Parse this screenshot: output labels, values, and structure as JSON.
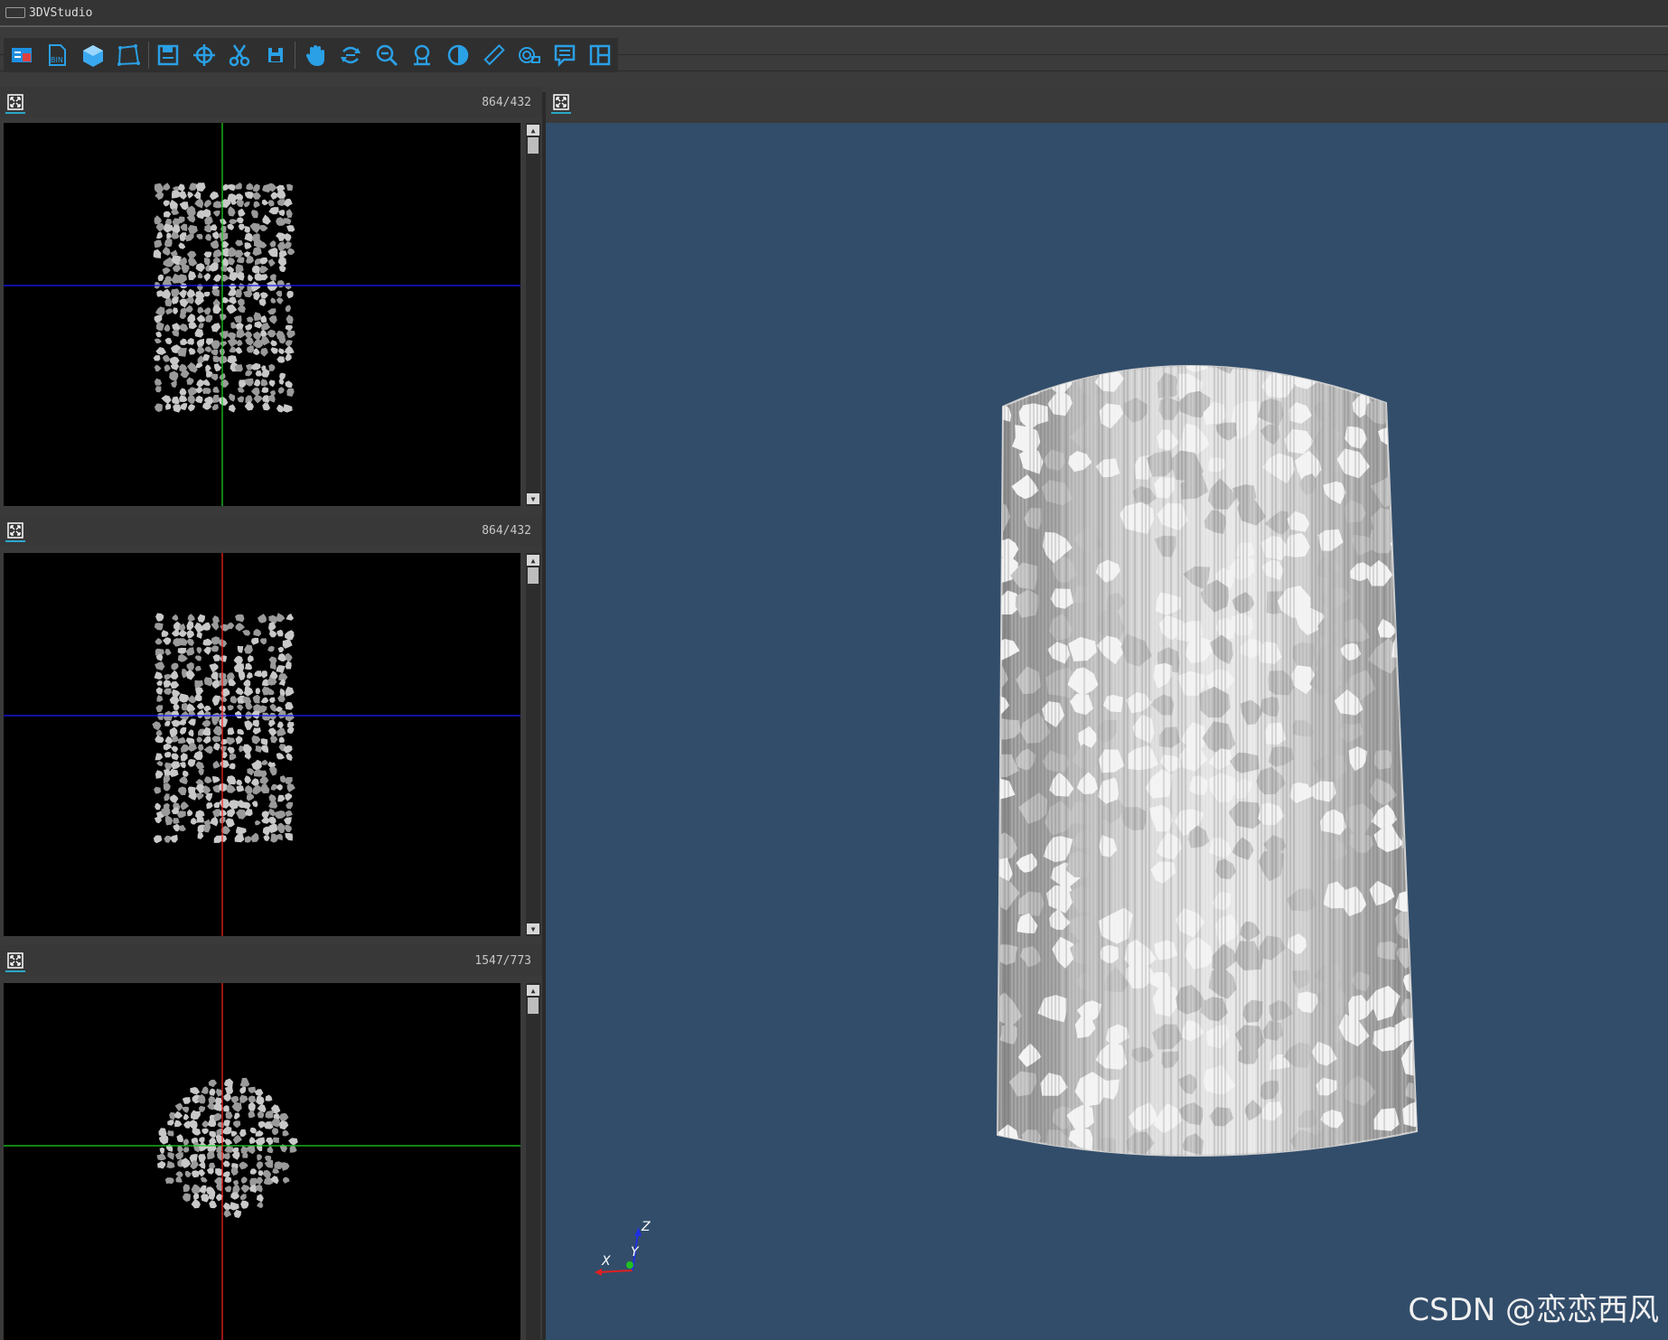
{
  "app": {
    "title": "3DVStudio"
  },
  "toolbar": {
    "buttons": [
      {
        "name": "open-project-icon"
      },
      {
        "name": "bin-file-icon"
      },
      {
        "name": "cube-icon"
      },
      {
        "name": "polygon-select-icon"
      },
      {
        "name": "save-icon"
      },
      {
        "name": "crosshair-icon"
      },
      {
        "name": "scissors-icon"
      },
      {
        "name": "save-as-icon"
      },
      {
        "name": "pan-hand-icon"
      },
      {
        "name": "rotate-icon"
      },
      {
        "name": "zoom-out-icon"
      },
      {
        "name": "measure-icon"
      },
      {
        "name": "contrast-icon"
      },
      {
        "name": "ruler-icon"
      },
      {
        "name": "annotation-icon"
      },
      {
        "name": "comment-icon"
      },
      {
        "name": "layout-icon"
      }
    ]
  },
  "panels": [
    {
      "slice": "864/432",
      "h_line": "#1a1aff",
      "v_line": "#1fd41f"
    },
    {
      "slice": "864/432",
      "h_line": "#1a1aff",
      "v_line": "#ff2020"
    },
    {
      "slice": "1547/773",
      "h_line": "#1fd41f",
      "v_line": "#ff2020"
    }
  ],
  "view3d": {
    "background": "#324d6a",
    "axes": {
      "x": "X",
      "y": "Y",
      "z": "Z"
    }
  },
  "watermark": "CSDN @恋恋西风"
}
